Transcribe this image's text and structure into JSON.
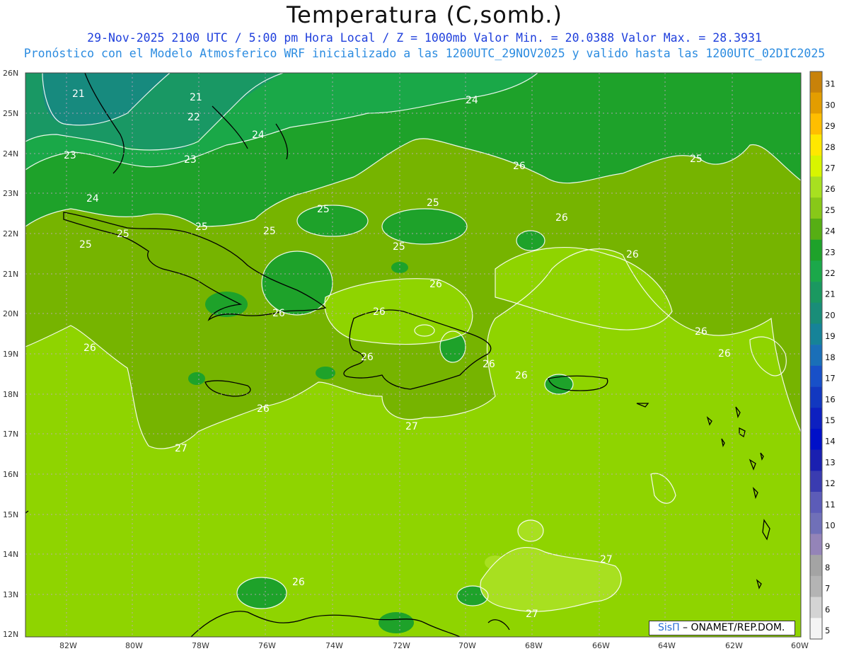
{
  "title": "Temperatura (C,somb.)",
  "subtitle_line1": "29-Nov-2025 2100 UTC / 5:00 pm Hora Local / Z = 1000mb   Valor Min. = 20.0388  Valor Max. = 28.3931",
  "subtitle_line2": "Pronóstico con el Modelo Atmosferico WRF inicializado a las 1200UTC_29NOV2025 y valido hasta las  1200UTC_02DIC2025",
  "credit": {
    "logo": "SisΠ",
    "text": " – ONAMET/REP.DOM."
  },
  "map": {
    "lat_labels": [
      "26N",
      "25N",
      "24N",
      "23N",
      "22N",
      "21N",
      "20N",
      "19N",
      "18N",
      "17N",
      "16N",
      "15N",
      "14N",
      "13N",
      "12N"
    ],
    "lon_labels": [
      "82W",
      "80W",
      "78W",
      "76W",
      "74W",
      "72W",
      "70W",
      "68W",
      "66W",
      "64W",
      "62W",
      "60W"
    ],
    "contour_labels": [
      "21",
      "21",
      "22",
      "23",
      "23",
      "24",
      "24",
      "24",
      "25",
      "25",
      "25",
      "25",
      "25",
      "25",
      "25",
      "25",
      "26",
      "26",
      "26",
      "26",
      "26",
      "26",
      "26",
      "26",
      "26",
      "26",
      "26",
      "26",
      "26",
      "27",
      "27"
    ]
  },
  "colorbar": {
    "values": [
      "31",
      "30",
      "29",
      "28",
      "27",
      "26",
      "25",
      "24",
      "23",
      "22",
      "21",
      "20",
      "19",
      "18",
      "17",
      "16",
      "15",
      "14",
      "13",
      "12",
      "11",
      "10",
      "9",
      "8",
      "7",
      "6",
      "5"
    ],
    "colors": [
      "#c8820a",
      "#e39d00",
      "#ffbe00",
      "#ffe800",
      "#d8f500",
      "#a8e020",
      "#88c818",
      "#56ae14",
      "#1ea22a",
      "#1ba84a",
      "#1a9860",
      "#198d78",
      "#168398",
      "#1a6fb8",
      "#1850c8",
      "#1238c0",
      "#0d20c0",
      "#0010c8",
      "#1a20b0",
      "#3a3cb0",
      "#5c5cb8",
      "#7070b8",
      "#9484b8",
      "#a4a4a4",
      "#b4b4b4",
      "#d4d4d4",
      "#f4f4f4"
    ]
  }
}
